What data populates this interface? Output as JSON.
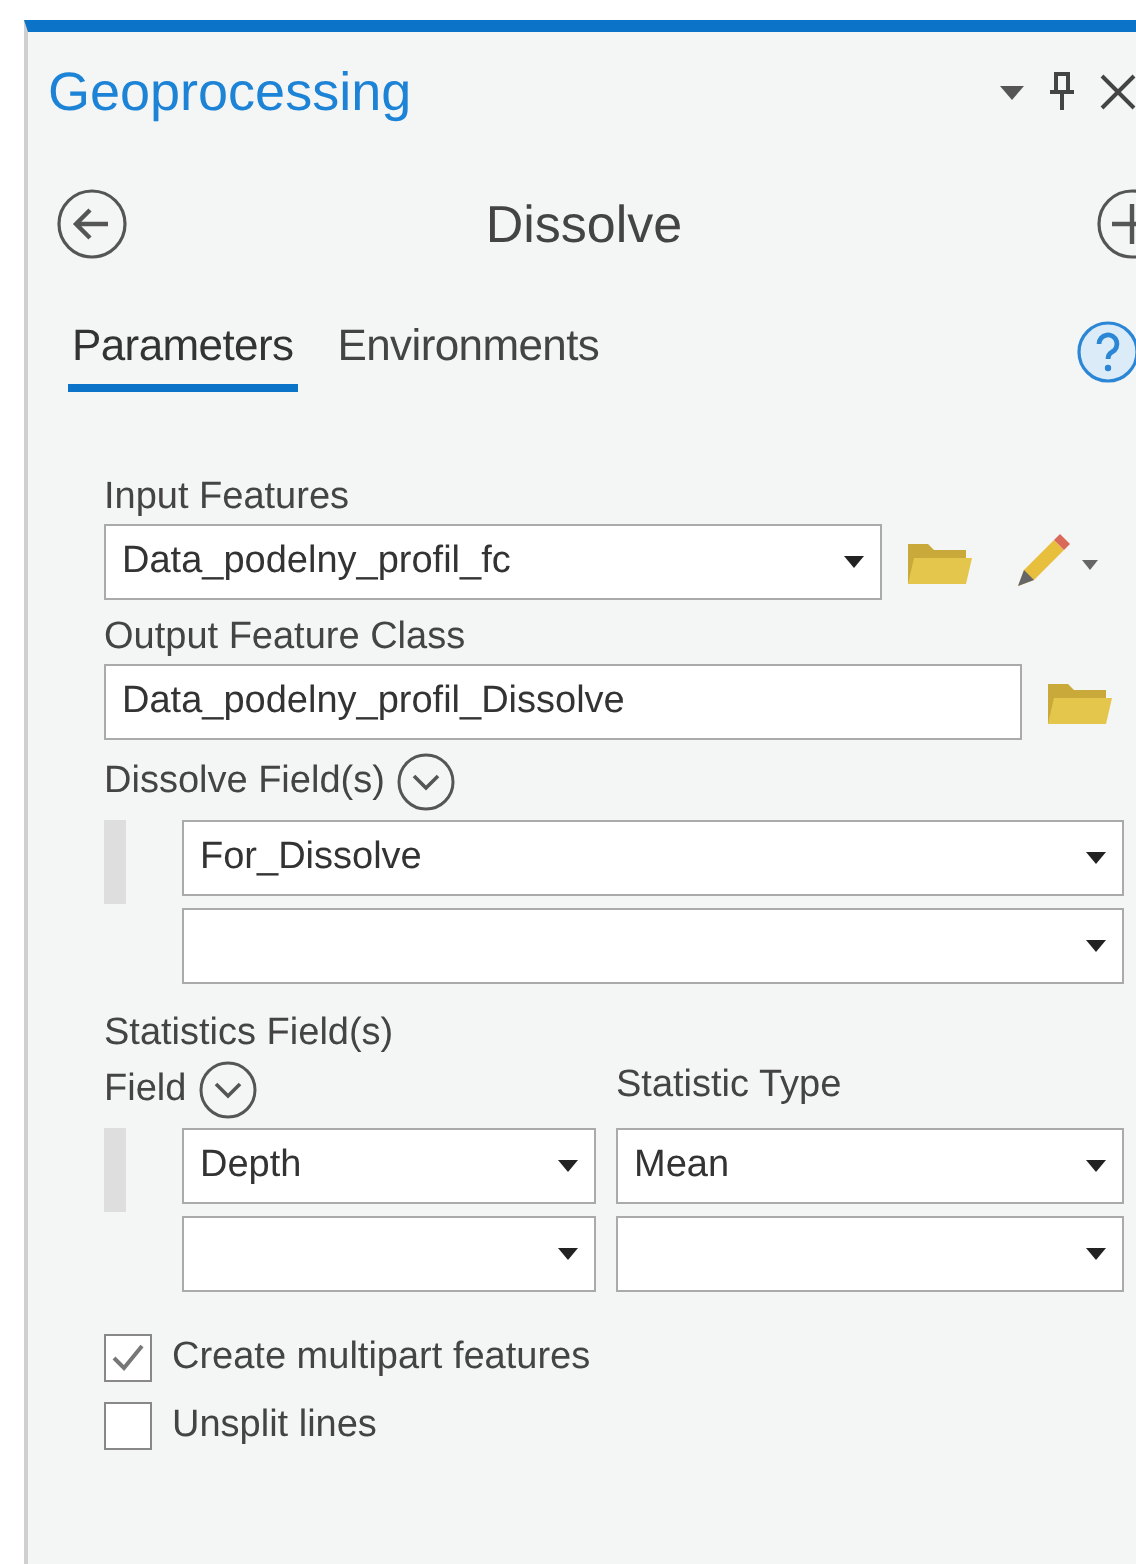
{
  "panel": {
    "title": "Geoprocessing"
  },
  "tool": {
    "title": "Dissolve"
  },
  "tabs": [
    {
      "label": "Parameters",
      "selected": true
    },
    {
      "label": "Environments",
      "selected": false
    }
  ],
  "input_features": {
    "label": "Input Features",
    "value": "Data_podelny_profil_fc"
  },
  "output_feature_class": {
    "label": "Output Feature Class",
    "value": "Data_podelny_profil_Dissolve"
  },
  "dissolve_fields": {
    "label": "Dissolve Field(s)",
    "values": [
      "For_Dissolve"
    ]
  },
  "statistics_fields": {
    "label": "Statistics Field(s)",
    "field_header": "Field",
    "type_header": "Statistic Type",
    "rows": [
      {
        "field": "Depth",
        "statistic": "Mean"
      }
    ]
  },
  "options": [
    {
      "label": "Create multipart features",
      "checked": true
    },
    {
      "label": "Unsplit lines",
      "checked": false
    }
  ]
}
